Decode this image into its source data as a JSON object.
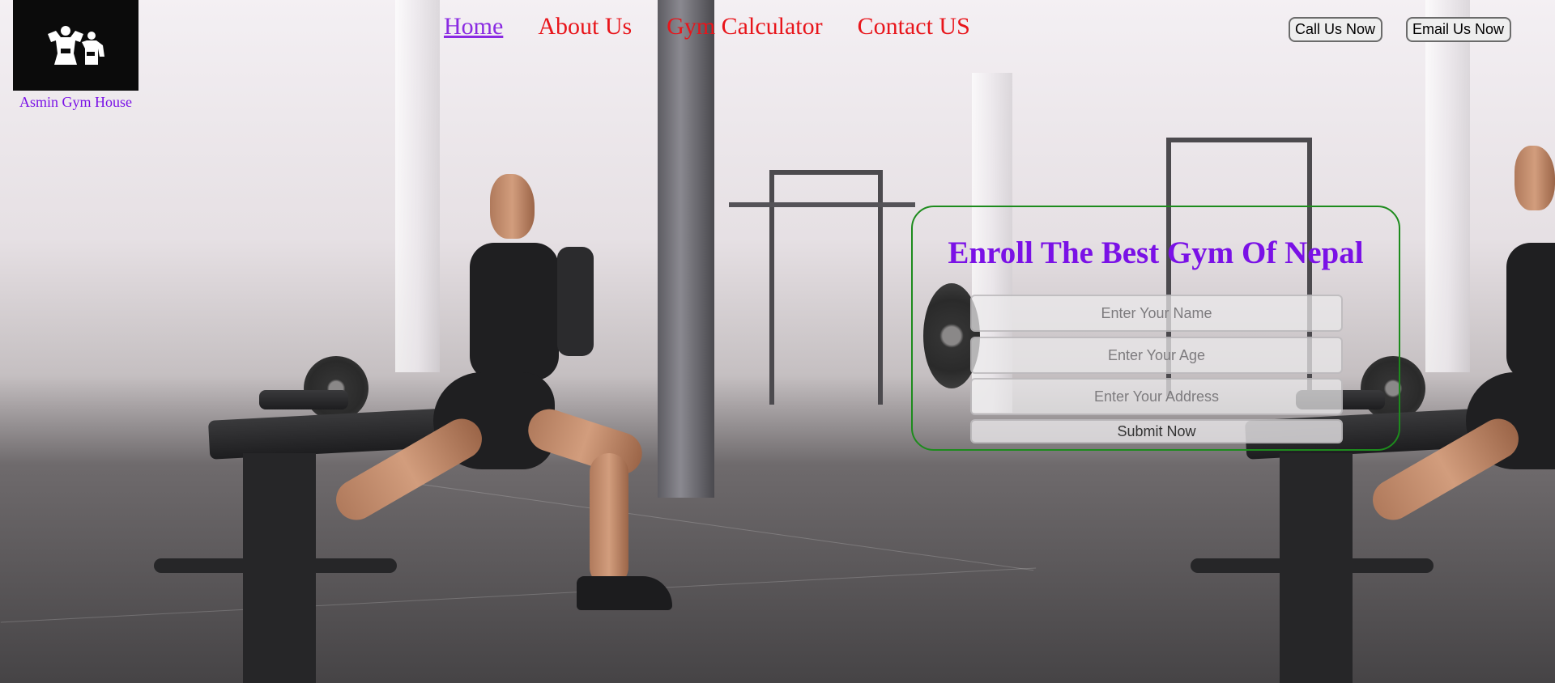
{
  "brand": {
    "name": "Asmin Gym House"
  },
  "nav": {
    "items": [
      {
        "label": "Home",
        "active": true
      },
      {
        "label": "About Us",
        "active": false
      },
      {
        "label": "Gym Calculator",
        "active": false
      },
      {
        "label": "Contact US",
        "active": false
      }
    ]
  },
  "actions": {
    "call_label": "Call Us Now",
    "email_label": "Email Us Now"
  },
  "enroll": {
    "title": "Enroll The Best Gym Of Nepal",
    "name_placeholder": "Enter Your Name",
    "age_placeholder": "Enter Your Age",
    "address_placeholder": "Enter Your Address",
    "submit_label": "Submit Now"
  },
  "colors": {
    "accent_purple": "#7a11e6",
    "nav_red": "#e8151b",
    "form_border": "#1d8b1d"
  },
  "icons": {
    "logo": "bodybuilder-logo-icon"
  }
}
